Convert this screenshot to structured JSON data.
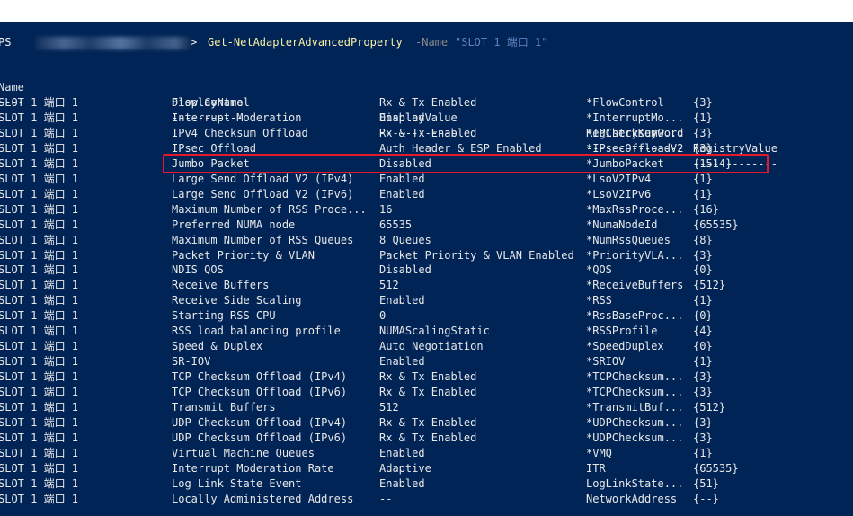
{
  "prompt": {
    "ps": "PS",
    "gt": ">",
    "cmdlet": "Get-NetAdapterAdvancedProperty",
    "param": "-Name",
    "arg": "\"SLOT 1 端口 1\""
  },
  "headers": [
    "Name",
    "DisplayName",
    "DisplayValue",
    "RegistryKeyword",
    "RegistryValue"
  ],
  "separators": [
    "----",
    "-----------",
    "------------",
    "---------------",
    "-------------"
  ],
  "rows": [
    [
      "SLOT 1 端口 1",
      "Flow Control",
      "Rx & Tx Enabled",
      "*FlowControl",
      "{3}"
    ],
    [
      "SLOT 1 端口 1",
      "Interrupt Moderation",
      "Enabled",
      "*InterruptMo...",
      "{1}"
    ],
    [
      "SLOT 1 端口 1",
      "IPv4 Checksum Offload",
      "Rx & Tx Enabled",
      "*IPChecksumO...",
      "{3}"
    ],
    [
      "SLOT 1 端口 1",
      "IPsec Offload",
      "Auth Header & ESP Enabled",
      "*IPsecOffloadV2",
      "{3}"
    ],
    [
      "SLOT 1 端口 1",
      "Jumbo Packet",
      "Disabled",
      "*JumboPacket",
      "{1514}"
    ],
    [
      "SLOT 1 端口 1",
      "Large Send Offload V2 (IPv4)",
      "Enabled",
      "*LsoV2IPv4",
      "{1}"
    ],
    [
      "SLOT 1 端口 1",
      "Large Send Offload V2 (IPv6)",
      "Enabled",
      "*LsoV2IPv6",
      "{1}"
    ],
    [
      "SLOT 1 端口 1",
      "Maximum Number of RSS Proce...",
      "16",
      "*MaxRssProce...",
      "{16}"
    ],
    [
      "SLOT 1 端口 1",
      "Preferred NUMA node",
      "65535",
      "*NumaNodeId",
      "{65535}"
    ],
    [
      "SLOT 1 端口 1",
      "Maximum Number of RSS Queues",
      "8 Queues",
      "*NumRssQueues",
      "{8}"
    ],
    [
      "SLOT 1 端口 1",
      "Packet Priority & VLAN",
      "Packet Priority & VLAN Enabled",
      "*PriorityVLA...",
      "{3}"
    ],
    [
      "SLOT 1 端口 1",
      "NDIS QOS",
      "Disabled",
      "*QOS",
      "{0}"
    ],
    [
      "SLOT 1 端口 1",
      "Receive Buffers",
      "512",
      "*ReceiveBuffers",
      "{512}"
    ],
    [
      "SLOT 1 端口 1",
      "Receive Side Scaling",
      "Enabled",
      "*RSS",
      "{1}"
    ],
    [
      "SLOT 1 端口 1",
      "Starting RSS CPU",
      "0",
      "*RssBaseProc...",
      "{0}"
    ],
    [
      "SLOT 1 端口 1",
      "RSS load balancing profile",
      "NUMAScalingStatic",
      "*RSSProfile",
      "{4}"
    ],
    [
      "SLOT 1 端口 1",
      "Speed & Duplex",
      "Auto Negotiation",
      "*SpeedDuplex",
      "{0}"
    ],
    [
      "SLOT 1 端口 1",
      "SR-IOV",
      "Enabled",
      "*SRIOV",
      "{1}"
    ],
    [
      "SLOT 1 端口 1",
      "TCP Checksum Offload (IPv4)",
      "Rx & Tx Enabled",
      "*TCPChecksum...",
      "{3}"
    ],
    [
      "SLOT 1 端口 1",
      "TCP Checksum Offload (IPv6)",
      "Rx & Tx Enabled",
      "*TCPChecksum...",
      "{3}"
    ],
    [
      "SLOT 1 端口 1",
      "Transmit Buffers",
      "512",
      "*TransmitBuf...",
      "{512}"
    ],
    [
      "SLOT 1 端口 1",
      "UDP Checksum Offload (IPv4)",
      "Rx & Tx Enabled",
      "*UDPChecksum...",
      "{3}"
    ],
    [
      "SLOT 1 端口 1",
      "UDP Checksum Offload (IPv6)",
      "Rx & Tx Enabled",
      "*UDPChecksum...",
      "{3}"
    ],
    [
      "SLOT 1 端口 1",
      "Virtual Machine Queues",
      "Enabled",
      "*VMQ",
      "{1}"
    ],
    [
      "SLOT 1 端口 1",
      "Interrupt Moderation Rate",
      "Adaptive",
      "ITR",
      "{65535}"
    ],
    [
      "SLOT 1 端口 1",
      "Log Link State Event",
      "Enabled",
      "LogLinkState...",
      "{51}"
    ],
    [
      "SLOT 1 端口 1",
      "Locally Administered Address",
      "--",
      "NetworkAddress",
      "{--}"
    ]
  ],
  "highlighted_row": 4,
  "colors": {
    "console_bg": "#012456",
    "text": "#e8e8e8",
    "cmdlet": "#f9f1a5",
    "parameter": "#8a8a8a",
    "string": "#5f7fbf",
    "highlight_border": "#e5182c"
  }
}
